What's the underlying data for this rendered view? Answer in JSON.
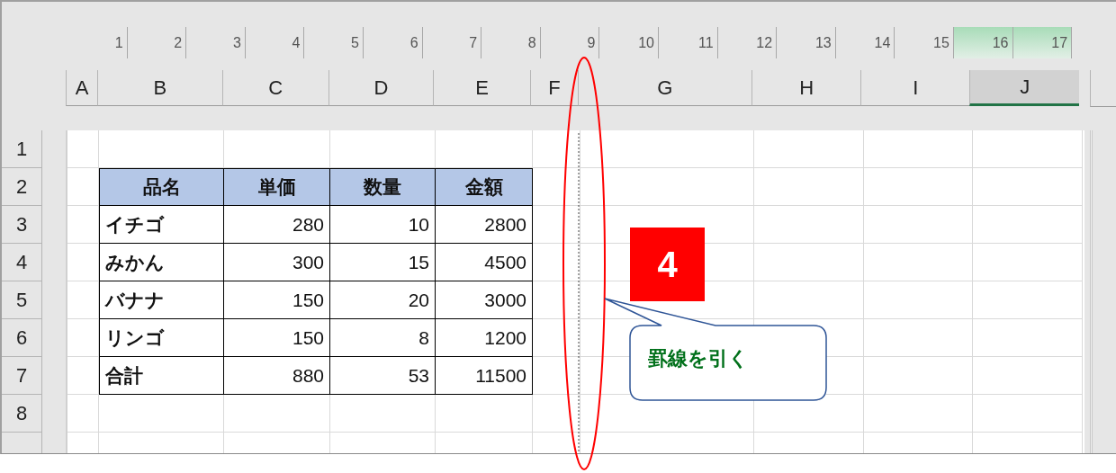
{
  "ruler": {
    "marks": [
      {
        "label": "1",
        "selected": false
      },
      {
        "label": "2",
        "selected": false
      },
      {
        "label": "3",
        "selected": false
      },
      {
        "label": "4",
        "selected": false
      },
      {
        "label": "5",
        "selected": false
      },
      {
        "label": "6",
        "selected": false
      },
      {
        "label": "7",
        "selected": false
      },
      {
        "label": "8",
        "selected": false
      },
      {
        "label": "9",
        "selected": false
      },
      {
        "label": "10",
        "selected": false
      },
      {
        "label": "11",
        "selected": false
      },
      {
        "label": "12",
        "selected": false
      },
      {
        "label": "13",
        "selected": false
      },
      {
        "label": "14",
        "selected": false
      },
      {
        "label": "15",
        "selected": false
      },
      {
        "label": "16",
        "selected": true
      },
      {
        "label": "17",
        "selected": true
      }
    ]
  },
  "columns": [
    {
      "label": "A",
      "selected": false
    },
    {
      "label": "B",
      "selected": false
    },
    {
      "label": "C",
      "selected": false
    },
    {
      "label": "D",
      "selected": false
    },
    {
      "label": "E",
      "selected": false
    },
    {
      "label": "F",
      "selected": false
    },
    {
      "label": "G",
      "selected": false
    },
    {
      "label": "H",
      "selected": false
    },
    {
      "label": "I",
      "selected": false
    },
    {
      "label": "J",
      "selected": true
    }
  ],
  "row_headers": [
    "1",
    "2",
    "3",
    "4",
    "5",
    "6",
    "7",
    "8"
  ],
  "table": {
    "columns": [
      "品名",
      "単価",
      "数量",
      "金額"
    ],
    "rows": [
      [
        "イチゴ",
        "280",
        "10",
        "2800"
      ],
      [
        "みかん",
        "300",
        "15",
        "4500"
      ],
      [
        "バナナ",
        "150",
        "20",
        "3000"
      ],
      [
        "リンゴ",
        "150",
        "8",
        "1200"
      ],
      [
        "合計",
        "880",
        "53",
        "11500"
      ]
    ]
  },
  "step_badge": {
    "label": "4"
  },
  "callout": {
    "text": "罫線を引く"
  }
}
